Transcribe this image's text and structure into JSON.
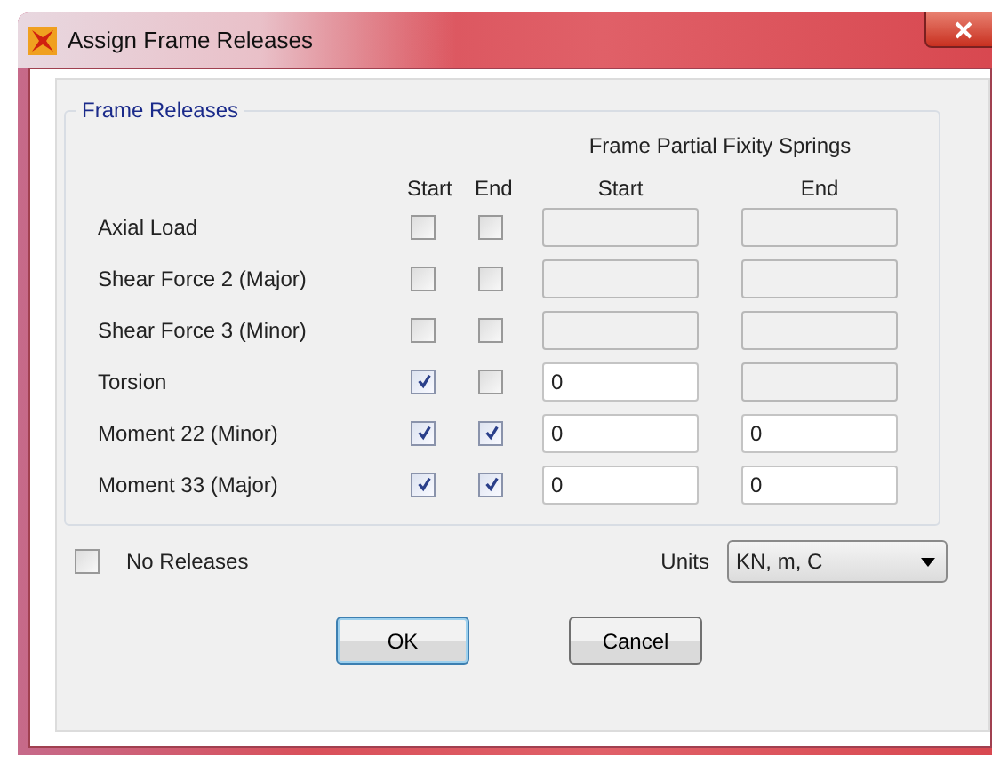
{
  "window": {
    "title": "Assign Frame Releases"
  },
  "group": {
    "title": "Frame Releases",
    "springs_heading": "Frame Partial Fixity Springs",
    "release_headings": [
      "Start",
      "End"
    ],
    "spring_headings": [
      "Start",
      "End"
    ],
    "rows": [
      {
        "label": "Axial Load",
        "start_checked": false,
        "end_checked": false,
        "start_spring": {
          "enabled": false
        },
        "end_spring": {
          "enabled": false
        }
      },
      {
        "label": "Shear Force 2 (Major)",
        "start_checked": false,
        "end_checked": false,
        "start_spring": {
          "enabled": false
        },
        "end_spring": {
          "enabled": false
        }
      },
      {
        "label": "Shear Force 3 (Minor)",
        "start_checked": false,
        "end_checked": false,
        "start_spring": {
          "enabled": false
        },
        "end_spring": {
          "enabled": false
        }
      },
      {
        "label": "Torsion",
        "start_checked": true,
        "end_checked": false,
        "start_spring": {
          "enabled": true,
          "value": "0"
        },
        "end_spring": {
          "enabled": false
        }
      },
      {
        "label": "Moment 22 (Minor)",
        "start_checked": true,
        "end_checked": true,
        "start_spring": {
          "enabled": true,
          "value": "0"
        },
        "end_spring": {
          "enabled": true,
          "value": "0"
        }
      },
      {
        "label": "Moment 33 (Major)",
        "start_checked": true,
        "end_checked": true,
        "start_spring": {
          "enabled": true,
          "value": "0"
        },
        "end_spring": {
          "enabled": true,
          "value": "0"
        }
      }
    ]
  },
  "no_releases": {
    "label": "No Releases",
    "checked": false
  },
  "units": {
    "label": "Units",
    "value": "KN, m, C"
  },
  "buttons": [
    {
      "label": "OK",
      "default": true
    },
    {
      "label": "Cancel",
      "default": false
    }
  ]
}
